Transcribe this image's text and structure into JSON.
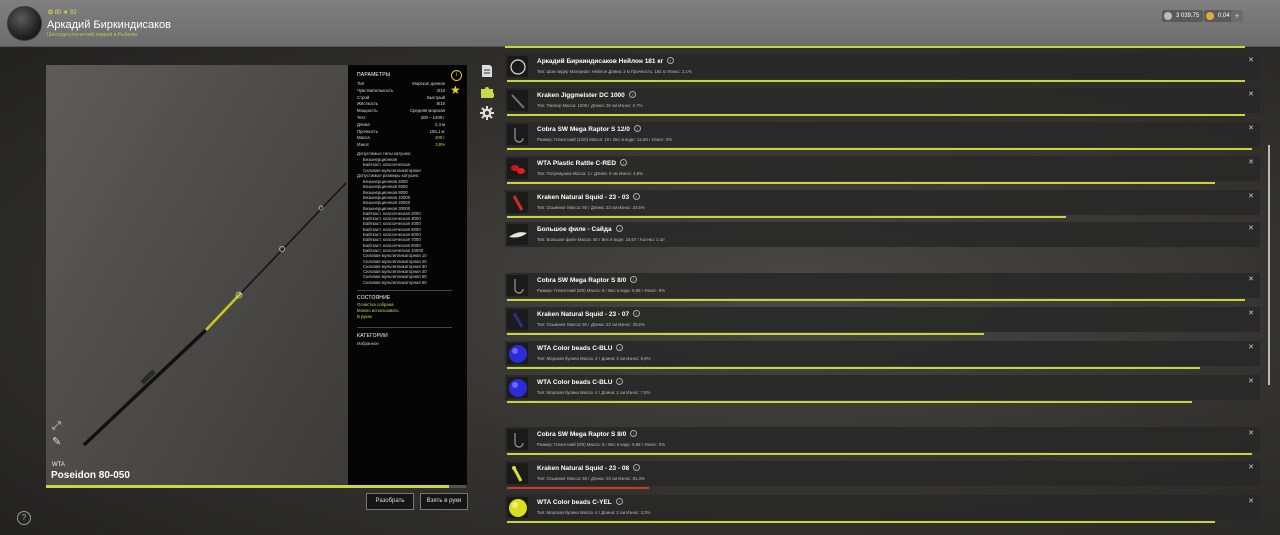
{
  "header": {
    "levels": "✪ 80 ★ 82",
    "player_name": "Аркадий Биркиндисаков",
    "player_sub": "Шестидесятилетний лаврей в Рыбалке",
    "currency_silver": "3 039,75",
    "currency_gold": "0,04",
    "plus_label": "+"
  },
  "rod": {
    "brand": "WTA",
    "name": "Poseidon 80-050",
    "progress": 0.96
  },
  "spec": {
    "params_title": "ПАРАМЕТРЫ",
    "params": [
      {
        "k": "Тип",
        "v": "Морское донное"
      },
      {
        "k": "Чувствительность",
        "v": "3/10"
      },
      {
        "k": "Строй",
        "v": "Быстрый"
      },
      {
        "k": "Жёсткость",
        "v": "8/10"
      },
      {
        "k": "Мощность",
        "v": "Средняя морская"
      },
      {
        "k": "Тест",
        "v": "200 – 1400 г"
      },
      {
        "k": "Длина",
        "v": "2,4 м"
      },
      {
        "k": "Прочность",
        "v": "193,1 кг"
      },
      {
        "k": "Масса",
        "v": "200 г"
      },
      {
        "k": "Износ",
        "v": "3,8%"
      }
    ],
    "reels_title": "Допустимые типы катушек:",
    "reels": [
      "Безынерционная",
      "Байткаст. классическая",
      "Силовая мультипликаторная"
    ],
    "sizes_title": "Допустимые размеры катушек:",
    "sizes": [
      "Безынерционная 4000",
      "Безынерционная 6000",
      "Безынерционная 8000",
      "Безынерционная 10000",
      "Безынерционная 20000",
      "Безынерционная 30000",
      "Байткаст. классическая 2000",
      "Байткаст. классическая 3000",
      "Байткаст. классическая 4000",
      "Байткаст. классическая 5000",
      "Байткаст. классическая 6000",
      "Байткаст. классическая 7000",
      "Байткаст. классическая 8000",
      "Байткаст. классическая 10000",
      "Силовая мультипликаторная 10",
      "Силовая мультипликаторная 20",
      "Силовая мультипликаторная 30",
      "Силовая мультипликаторная 40",
      "Силовая мультипликаторная 50",
      "Силовая мультипликаторная 60"
    ],
    "state_title": "СОСТОЯНИЕ",
    "state": [
      "Оснастка собрана",
      "Можно использовать",
      "В руках"
    ],
    "cat_title": "КАТЕГОРИИ",
    "cat": "Избранное",
    "info_icon": "info-icon",
    "star_icon": "favorite-star-icon"
  },
  "buttons": {
    "disassemble": "Разобрать",
    "take": "Взять в руки",
    "help": "?"
  },
  "items": [
    {
      "name": "Аркадий Биркиндисаков Нейлон 181 кг",
      "props": "Тип: Шок-лидер  Материал: Нейлон  Длина: 2 м  Прочность: 181 кг  Износ: 1,1%",
      "wear": 0.99,
      "icon": "line-coil"
    },
    {
      "name": "Kraken Jiggmeister DC 1000",
      "props": "Тип: Пилкер  Масса: 1000 г  Длина: 26 см  Износ: 0,7%",
      "wear": 0.99,
      "icon": "pilker"
    },
    {
      "name": "Cobra SW Mega Raptor S 12/0",
      "props": "Размер: Гигантский (12/0)  Масса: 10 г  Вес в воде: 12,69 г  Износ: 0%",
      "wear": 1.0,
      "icon": "hook"
    },
    {
      "name": "WTA Plastic Rattle C-RED",
      "props": "Тип: Погремушка  Масса: 1 г  Длина: 0 см  Износ: 4,9%",
      "wear": 0.95,
      "icon": "rattle-red"
    },
    {
      "name": "Kraken Natural Squid - 23 - 03",
      "props": "Тип: Осьминог  Масса: 50 г  Длина: 23 см  Износ: 24,6%",
      "wear": 0.75,
      "icon": "squid-red"
    },
    {
      "name": "Большое филе - Сайда",
      "props": "Тип: Большое филе  Масса: 50 г  Вес в воде: 16,67 г  Кол-во: 1 шт",
      "wear": 0.0,
      "icon": "fillet"
    },
    {
      "name": "Cobra SW Mega Raptor S 8/0",
      "props": "Размер: Гигантский (8/0)  Масса: 8 г  Вес в воде: 6,98 г  Износ: 9%",
      "wear": 0.99,
      "icon": "hook"
    },
    {
      "name": "Kraken Natural Squid - 23 - 07",
      "props": "Тип: Осьминог  Масса: 50 г  Длина: 23 см  Износ: 25,6%",
      "wear": 0.64,
      "icon": "squid-blue"
    },
    {
      "name": "WTA Color beads C-BLU",
      "props": "Тип: Морская бусина  Масса: 4 г  Длина: 2 см  Износ: 6,9%",
      "wear": 0.93,
      "icon": "bead-blue"
    },
    {
      "name": "WTA Color beads C-BLU",
      "props": "Тип: Морская бусина  Масса: 4 г  Длина: 2 см  Износ: 7,5%",
      "wear": 0.92,
      "icon": "bead-blue"
    },
    {
      "name": "Cobra SW Mega Raptor S 8/0",
      "props": "Размер: Гигантский (8/0)  Масса: 8 г  Вес в воде: 6,98 г  Износ: 0%",
      "wear": 1.0,
      "icon": "hook"
    },
    {
      "name": "Kraken Natural Squid - 23 - 08",
      "props": "Тип: Осьминог  Масса: 50 г  Длина: 23 см  Износ: 81,3%",
      "wear": 0.19,
      "icon": "squid-yellow"
    },
    {
      "name": "WTA Color beads C-YEL",
      "props": "Тип: Морская бусина  Масса: 4 г  Длина: 2 см  Износ: 3,3%",
      "wear": 0.95,
      "icon": "bead-yellow"
    }
  ],
  "colors": {
    "accent": "#c8d63e",
    "danger": "#c83a2a"
  }
}
